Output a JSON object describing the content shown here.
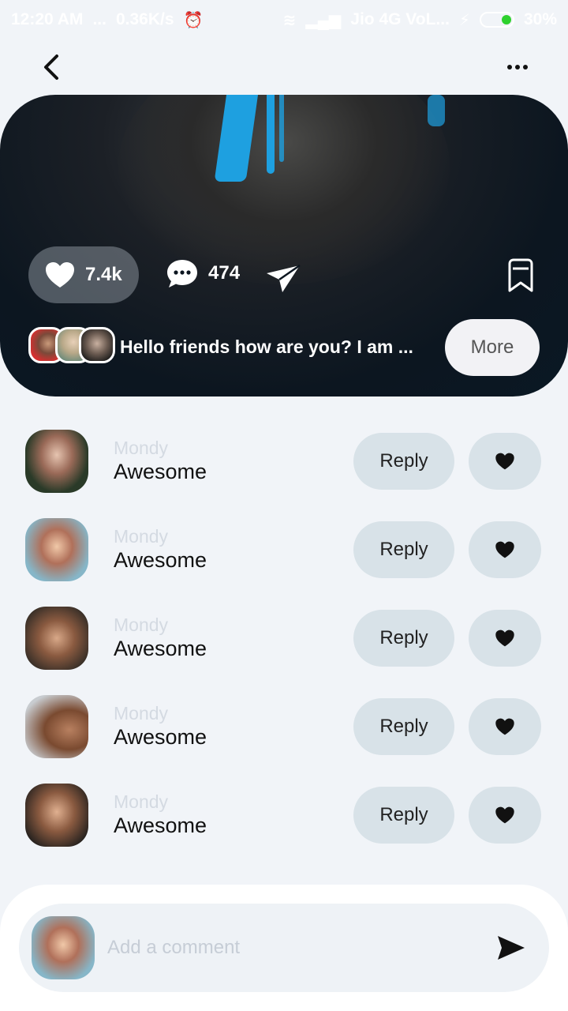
{
  "status_bar": {
    "time": "12:20 AM",
    "speed": "0.36K/s",
    "carrier": "Jio 4G VoL...",
    "battery": "30%"
  },
  "post": {
    "likes": "7.4k",
    "comments": "474",
    "caption": "Hello friends how are you? I am ...",
    "more_label": "More"
  },
  "comments": [
    {
      "name": "Mondy",
      "text": "Awesome",
      "reply_label": "Reply"
    },
    {
      "name": "Mondy",
      "text": "Awesome",
      "reply_label": "Reply"
    },
    {
      "name": "Mondy",
      "text": "Awesome",
      "reply_label": "Reply"
    },
    {
      "name": "Mondy",
      "text": "Awesome",
      "reply_label": "Reply"
    },
    {
      "name": "Mondy",
      "text": "Awesome",
      "reply_label": "Reply"
    }
  ],
  "composer": {
    "placeholder": "Add a comment"
  },
  "colors": {
    "background": "#f1f4f8",
    "hero_dark": "#0c1620",
    "pill": "#d8e2e8",
    "accent_blue": "#1ea0e0"
  },
  "icons": [
    "back-arrow-icon",
    "more-dots-icon",
    "heart-icon",
    "comment-bubble-icon",
    "send-icon",
    "bookmark-icon"
  ]
}
